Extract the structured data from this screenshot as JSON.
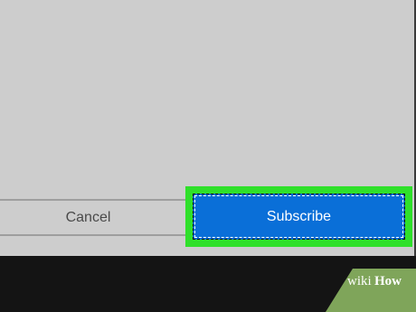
{
  "dialog": {
    "cancel_label": "Cancel",
    "subscribe_label": "Subscribe"
  },
  "watermark": {
    "wiki": "wiki",
    "how": "How"
  },
  "colors": {
    "dialog_background": "#cdcdcd",
    "primary_button": "#0a6fd8",
    "highlight": "#2fe02a",
    "screen_background": "#141414",
    "watermark_green": "#7fa55a"
  }
}
